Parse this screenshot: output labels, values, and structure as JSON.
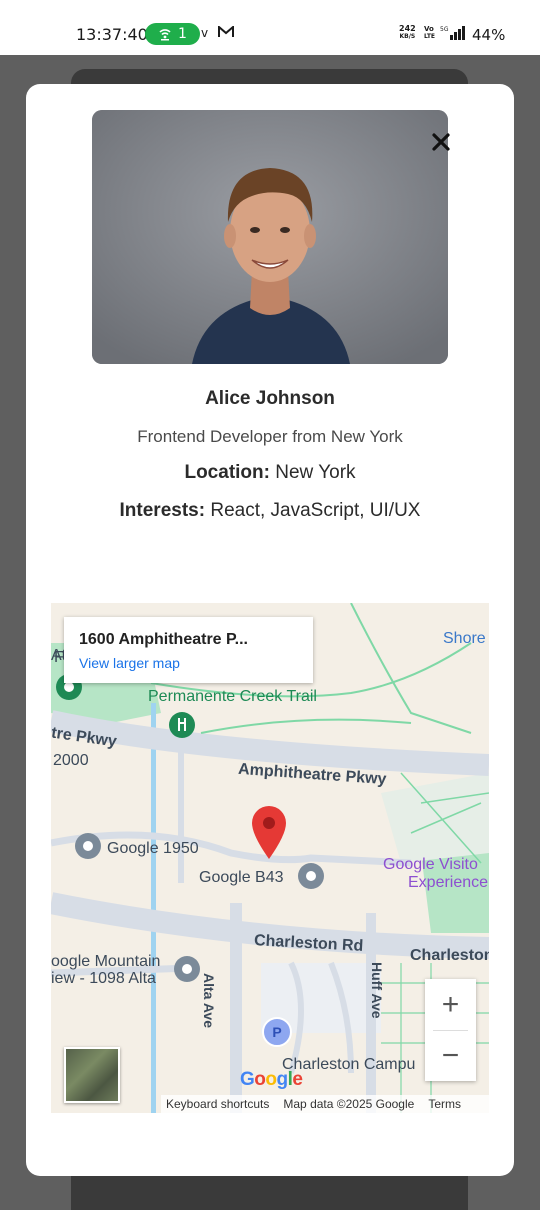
{
  "status_bar": {
    "time": "13:37:40",
    "hotspot_count": "1",
    "carrier_v": "v",
    "speed_value": "242",
    "speed_unit": "KB/S",
    "volte_top": "Vo",
    "volte_bottom": "LTE",
    "network": "5G",
    "battery": "44%"
  },
  "profile": {
    "name": "Alice Johnson",
    "description": "Frontend Developer from New York",
    "location_label": "Location:",
    "location_value": "New York",
    "interests_label": "Interests:",
    "interests_value": "React, JavaScript, UI/UX"
  },
  "map": {
    "place_title": "1600 Amphitheatre P...",
    "view_larger": "View larger map",
    "labels": {
      "shore": "Shore",
      "permanente": "Permanente Creek Trail",
      "tre_pkwy": "tre Pkwy",
      "n2000": "2000",
      "amphitheatre": "Amphitheatre Pkwy",
      "google1950": "Google 1950",
      "googleb43": "Google B43",
      "visitor1": "Google Visito",
      "visitor2": "Experience",
      "charleston_rd": "Charleston Rd",
      "charleston_right": "Charleston",
      "mountain1": "oogle Mountain",
      "mountain2": "iew - 1098 Alta",
      "alta_ave": "Alta Ave",
      "huff_ave": "Huff Ave",
      "campus": "Charleston Campu",
      "at": "At",
      "f": "F"
    },
    "zoom_in": "+",
    "zoom_out": "−",
    "google": "Google",
    "keyboard_shortcuts": "Keyboard shortcuts",
    "map_data": "Map data ©2025 Google",
    "terms": "Terms",
    "parking": "P"
  },
  "colors": {
    "road": "#d7dde6",
    "park": "#b6e5c6",
    "trail": "#7fd8a6",
    "water": "#9fd3f0",
    "pin": "#e53935"
  }
}
